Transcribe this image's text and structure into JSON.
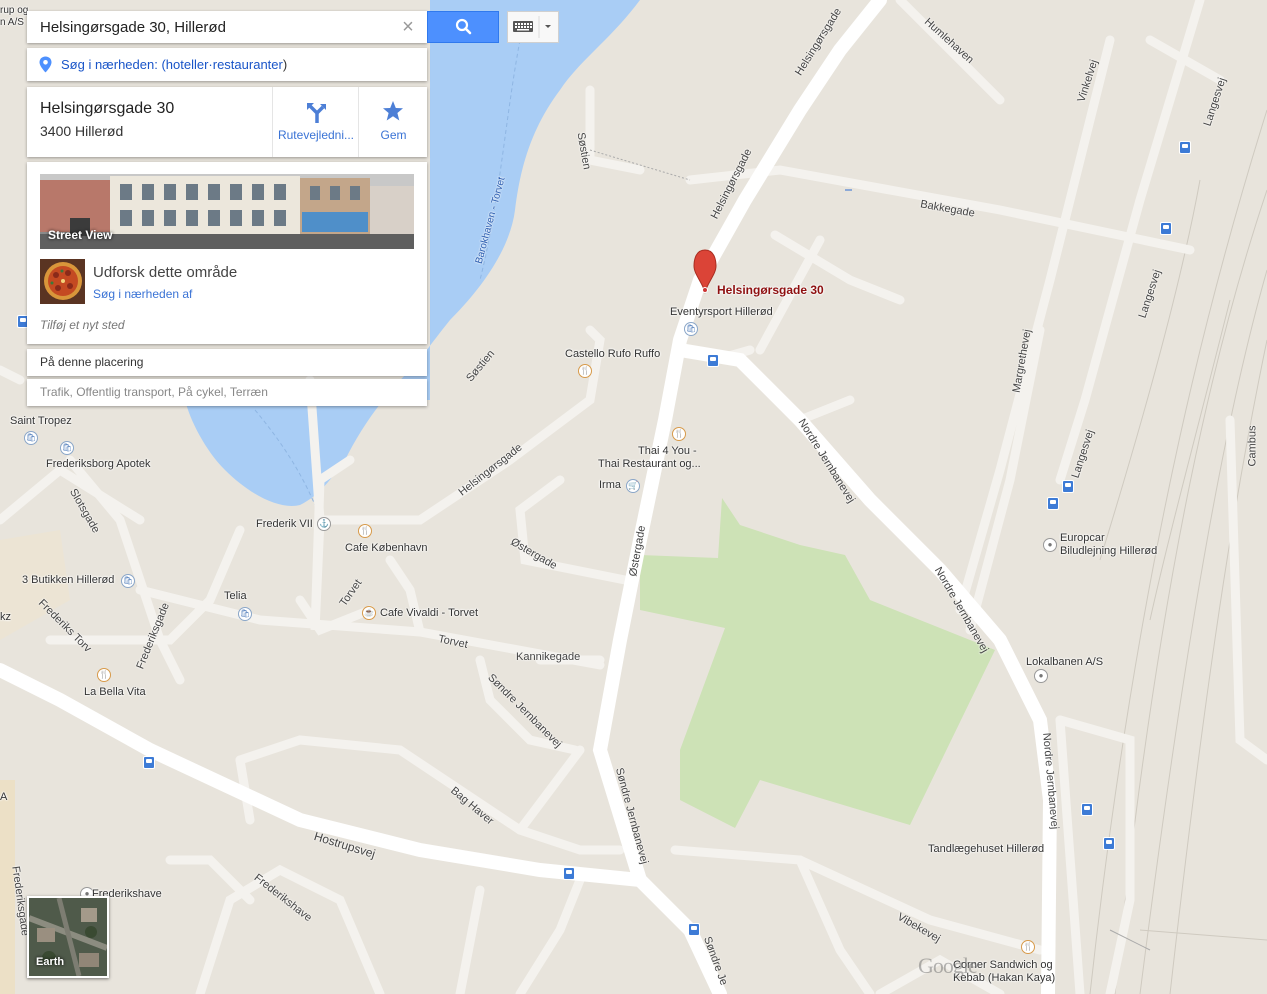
{
  "search": {
    "value": "Helsingørsgade 30, Hillerød",
    "placeholder": "",
    "clear_icon": "close-icon",
    "search_icon": "search-icon",
    "keyboard_icon": "keyboard-icon"
  },
  "nearby": {
    "prefix": "Søg i nærheden: (",
    "link": "hoteller·restauranter",
    "suffix": ")"
  },
  "place": {
    "address_line1": "Helsingørsgade 30",
    "address_line2": "3400 Hillerød",
    "directions_label": "Rutevejledni...",
    "save_label": "Gem"
  },
  "details": {
    "street_view_label": "Street View",
    "explore_title": "Udforsk dette område",
    "explore_link": "Søg i nærheden af",
    "add_place": "Tilføj et nyt sted"
  },
  "here_label": "På denne placering",
  "layers_label": "Trafik, Offentlig transport, På cykel, Terræn",
  "earth_label": "Earth",
  "google_logo": "Google",
  "marker": {
    "label": "Helsingørsgade 30",
    "color": "#db4437"
  },
  "map_labels": {
    "top_left_1": "rup og",
    "top_left_2": "n A/S",
    "eventyrsport": "Eventyrsport Hillerød",
    "castello": "Castello Rufo Ruffo",
    "thai_1": "Thai 4 You -",
    "thai_2": "Thai Restaurant og...",
    "irma": "Irma",
    "saint_tropez": "Saint Tropez",
    "frederiksborg_apotek": "Frederiksborg Apotek",
    "frederik_vii": "Frederik VII",
    "cafe_kobenhavn": "Cafe København",
    "butikken": "3 Butikken Hillerød",
    "telia": "Telia",
    "cafe_vivaldi": "Cafe Vivaldi - Torvet",
    "la_bella_vita": "La Bella Vita",
    "europcar_1": "Europcar",
    "europcar_2": "Biludlejning Hillerød",
    "lokalbanen": "Lokalbanen A/S",
    "tandlaege": "Tandlægehuset Hillerød",
    "corner_1": "Corner Sandwich og",
    "corner_2": "Kebab (Hakan Kaya)",
    "frederikshave": "Frederikshave",
    "kz": "kz",
    "a": "A"
  },
  "streets": {
    "helsingorsgade_n": "Helsingørsgade",
    "helsingorsgade_c": "Helsingørsgade",
    "helsingorsgade_w": "Helsingørsgade",
    "humlehaven": "Humlehaven",
    "vinkelvej": "Vinkelvej",
    "langesvej_1": "Langesvej",
    "langesvej_2": "Langesvej",
    "langesvej_3": "Langesvej",
    "sostien_1": "Søstien",
    "sostien_2": "Søstien",
    "barokhaven": "Barokhaven - Torvet",
    "bakkegade": "Bakkegade",
    "margrethevej": "Margrethevej",
    "nordre_1": "Nordre Jernbanevej",
    "nordre_2": "Nordre Jernbanevej",
    "nordre_3": "Nordre Jernbanevej",
    "ostergade_1": "Østergade",
    "ostergade_2": "Østergade",
    "slotsgade": "Slotsgade",
    "torvet_1": "Torvet",
    "torvet_2": "Torvet",
    "frederiksgade_1": "Frederiksgade",
    "frederiksgade_2": "Frederiksgade",
    "frederiks_torv": "Frederiks Torv",
    "kannikegade": "Kannikegade",
    "sondre_1": "Søndre Jernbanevej",
    "sondre_2": "Søndre Jernbanevej",
    "sondre_3": "Søndre Je",
    "bag_haver": "Bag Haver",
    "hostrupsvej": "Hostrupsvej",
    "frederikshave_st": "Frederikshave",
    "vibekevej": "Vibekevej",
    "cambus": "Cambus"
  },
  "colors": {
    "land": "#e8e4dc",
    "water": "#a9cdf5",
    "park": "#cde2b6",
    "road": "#ffffff",
    "accent": "#4d90fe",
    "link": "#3a73d5"
  }
}
